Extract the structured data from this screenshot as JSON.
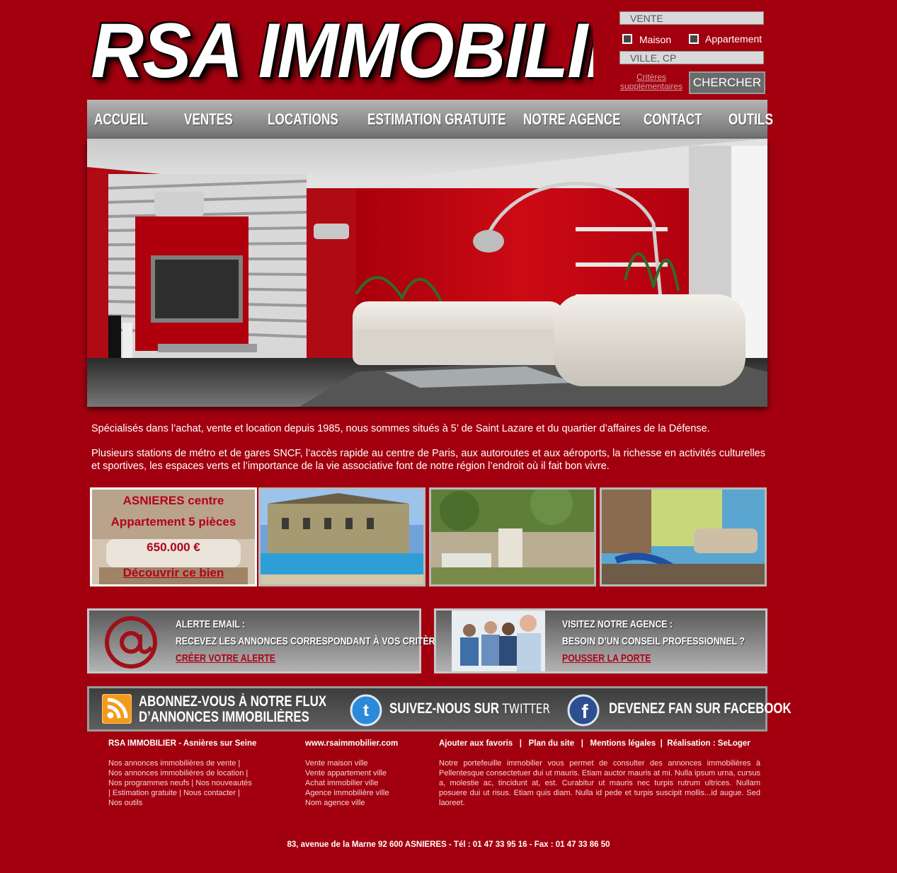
{
  "logo": "RSA IMMOBILIER",
  "search": {
    "type_select": "VENTE",
    "checkbox_maison": "Maison",
    "checkbox_appartement": "Appartement",
    "city_field": "VILLE, CP",
    "criteria_link": "Critères supplémentaires",
    "search_button": "CHERCHER"
  },
  "nav": [
    "ACCUEIL",
    "VENTES",
    "LOCATIONS",
    "ESTIMATION GRATUITE",
    "NOTRE AGENCE",
    "CONTACT",
    "OUTILS"
  ],
  "intro": {
    "p1": "Spécialisés dans l’achat, vente et location depuis 1985, nous sommes situés à 5’ de Saint Lazare et du quartier d’affaires de la Défense.",
    "p2": "Plusieurs stations de métro et de gares SNCF, l’accès rapide au centre de Paris, aux autoroutes et aux aéroports, la richesse en activités culturelles et sportives, les espaces verts et l’importance de la vie associative font de notre région l’endroit où il fait bon vivre."
  },
  "featured": {
    "line1": "ASNIERES centre",
    "line2": "Appartement 5 pièces",
    "price": "650.000 €",
    "link": "Découvrir ce bien"
  },
  "alert_box": {
    "title": "ALERTE EMAIL :",
    "text": "RECEVEZ LES ANNONCES CORRESPONDANT À VOS CRITÈRES",
    "link": "CRÉER VOTRE ALERTE"
  },
  "agency_box": {
    "title": "VISITEZ NOTRE AGENCE :",
    "text": "BESOIN D’UN CONSEIL PROFESSIONNEL ?",
    "link": "POUSSER LA PORTE"
  },
  "social": {
    "rss_line1": "ABONNEZ-VOUS À NOTRE FLUX",
    "rss_line2": "D’ANNONCES IMMOBILIÈRES",
    "twitter_prefix": "SUIVEZ-NOUS SUR",
    "twitter_name": "TWITTER",
    "facebook": "DEVENEZ FAN SUR FACEBOOK"
  },
  "footer": {
    "col1_title": "RSA IMMOBILIER - Asnières sur Seine",
    "col1_lines": [
      "Nos annonces immobilières de vente |",
      "Nos annonces immobilières de location |",
      "Nos programmes neufs | Nos nouveautés",
      "| Estimation gratuite | Nous contacter |",
      "Nos outils"
    ],
    "col2_title": "www.rsaimmobilier.com",
    "col2_links": [
      "Vente maison ville",
      "Vente appartement ville",
      "Achat immobilier ville",
      "Agence immobilière ville",
      "Nom agence ville"
    ],
    "col3_links": [
      "Ajouter aux favoris",
      "Plan du site",
      "Mentions légales",
      "Réalisation : SeLoger"
    ],
    "col3_sep": "|",
    "col3_text": "Notre portefeuille immobilier vous permet de consulter des annonces immobilières à Pellentesque consectetuer dui ut mauris. Etiam auctor mauris at mi. Nulla ipsum urna, cursus a, molestie ac, tincidunt at, est. Curabitur ut mauris nec turpis rutrum ultrices. Nullam posuere dui ut risus. Etiam quis diam. Nulla id pede et turpis suscipit mollis...id augue. Sed laoreet.",
    "address": "83, avenue de la Marne 92 600 ASNIERES - Tél : 01 47 33 95 16 - Fax : 01 47 33 86 50"
  }
}
